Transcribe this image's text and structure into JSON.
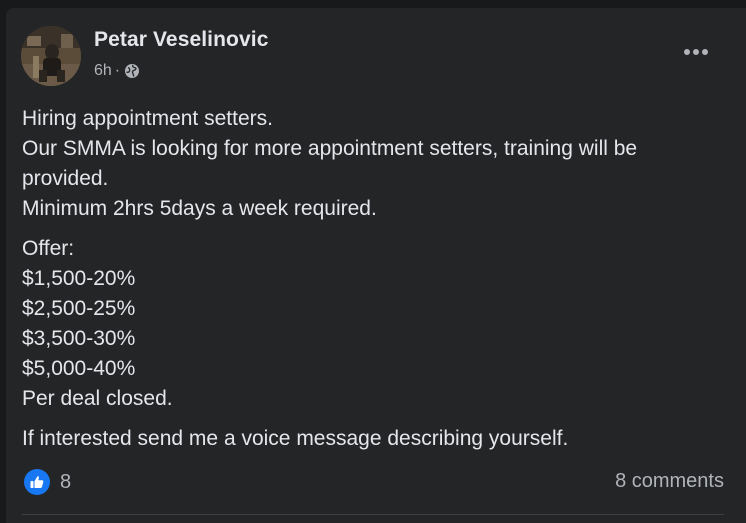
{
  "post": {
    "author": "Petar Veselinovic",
    "time": "6h",
    "separator": "·",
    "privacy_icon": "globe-icon",
    "more_icon": "more-horizontal-icon",
    "paragraphs": [
      {
        "lines": [
          "Hiring appointment setters.",
          "Our SMMA is looking for more appointment setters, training will be provided.",
          "Minimum 2hrs 5days a week required."
        ]
      },
      {
        "lines": [
          "Offer:",
          "$1,500-20%",
          "$2,500-25%",
          "$3,500-30%",
          "$5,000-40%",
          "Per deal closed."
        ]
      },
      {
        "lines": [
          "If interested send me a voice message describing yourself."
        ]
      }
    ],
    "reactions": {
      "icon": "like-icon",
      "count": "8",
      "color": "#1877f2"
    },
    "comments_label": "8 comments"
  },
  "colors": {
    "background": "#18191a",
    "card": "#242526",
    "primary_text": "#e4e6eb",
    "secondary_text": "#b0b3b8",
    "accent": "#1877f2"
  }
}
